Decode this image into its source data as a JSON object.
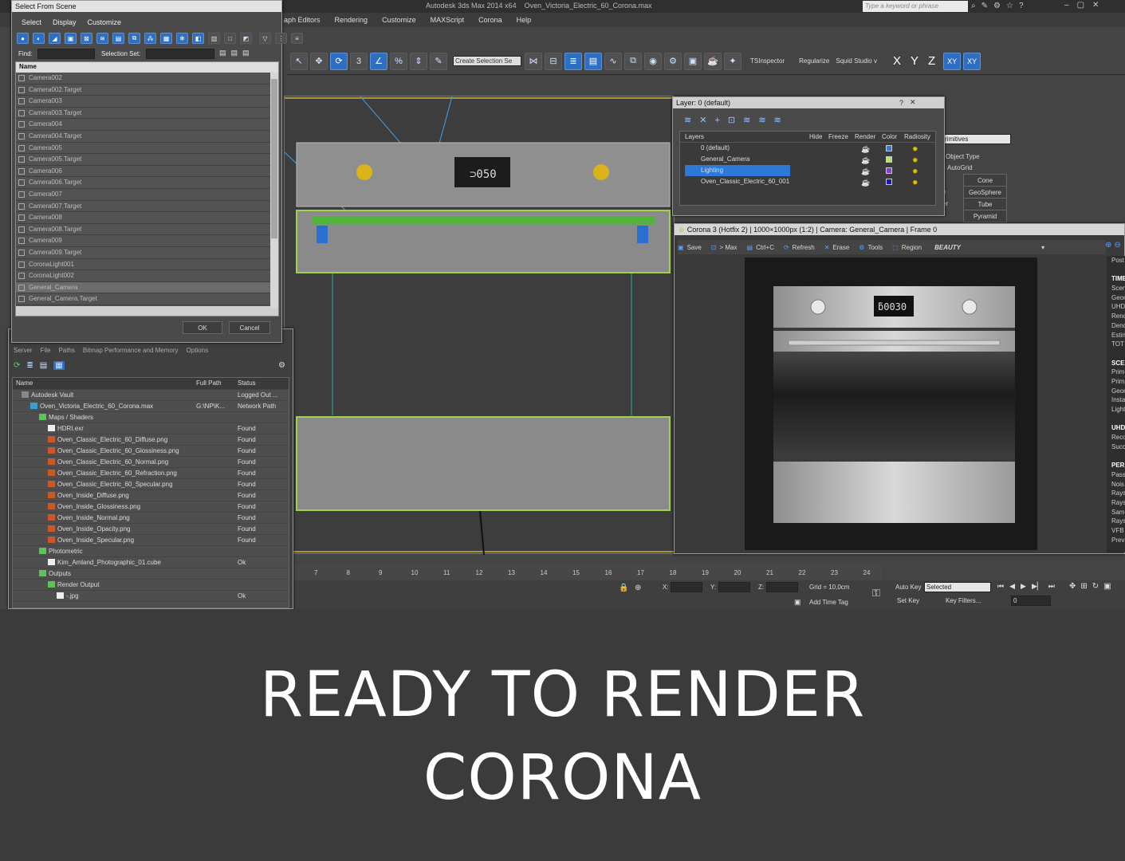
{
  "app": {
    "title": "Autodesk 3ds Max 2014 x64",
    "file": "Oven_Victoria_Electric_60_Corona.max",
    "search_placeholder": "Type a keyword or phrase",
    "menu": [
      "aph Editors",
      "Rendering",
      "Customize",
      "MAXScript",
      "Corona",
      "Help"
    ]
  },
  "toolbar": {
    "selection_set": "Create Selection Se",
    "tsinspector": "TSInspector",
    "regularize": "Regularize",
    "squid": "Squid Studio v",
    "axes": [
      "X",
      "Y",
      "Z",
      "XY",
      "XY"
    ]
  },
  "select_scene": {
    "title": "Select From Scene",
    "menu": [
      "Select",
      "Display",
      "Customize"
    ],
    "find_label": "Find:",
    "selection_set_label": "Selection Set:",
    "column": "Name",
    "items": [
      {
        "label": "Camera002",
        "selected": false
      },
      {
        "label": "Camera002.Target",
        "selected": false
      },
      {
        "label": "Camera003",
        "selected": false
      },
      {
        "label": "Camera003.Target",
        "selected": false
      },
      {
        "label": "Camera004",
        "selected": false
      },
      {
        "label": "Camera004.Target",
        "selected": false
      },
      {
        "label": "Camera005",
        "selected": false
      },
      {
        "label": "Camera005.Target",
        "selected": false
      },
      {
        "label": "Camera006",
        "selected": false
      },
      {
        "label": "Camera006.Target",
        "selected": false
      },
      {
        "label": "Camera007",
        "selected": false
      },
      {
        "label": "Camera007.Target",
        "selected": false
      },
      {
        "label": "Camera008",
        "selected": false
      },
      {
        "label": "Camera008.Target",
        "selected": false
      },
      {
        "label": "Camera009",
        "selected": false
      },
      {
        "label": "Camera009.Target",
        "selected": false
      },
      {
        "label": "CoronaLight001",
        "selected": false
      },
      {
        "label": "CoronaLight002",
        "selected": false
      },
      {
        "label": "General_Camera",
        "selected": true
      },
      {
        "label": "General_Camera.Target",
        "selected": false
      }
    ],
    "ok": "OK",
    "cancel": "Cancel"
  },
  "asset_tracking": {
    "menu": [
      "Server",
      "File",
      "Paths",
      "Bitmap Performance and Memory",
      "Options"
    ],
    "columns": [
      "Name",
      "Full Path",
      "Status"
    ],
    "rows": [
      {
        "indent": 1,
        "icon": "vault",
        "name": "Autodesk Vault",
        "path": "",
        "status": "Logged Out ..."
      },
      {
        "indent": 2,
        "icon": "max",
        "name": "Oven_Victoria_Electric_60_Corona.max",
        "path": "G:\\NP\\K...",
        "status": "Network Path"
      },
      {
        "indent": 3,
        "icon": "folder",
        "name": "Maps / Shaders",
        "path": "",
        "status": ""
      },
      {
        "indent": 4,
        "icon": "file",
        "name": "HDRI.exr",
        "path": "",
        "status": "Found"
      },
      {
        "indent": 4,
        "icon": "image",
        "name": "Oven_Classic_Electric_60_Diffuse.png",
        "path": "",
        "status": "Found"
      },
      {
        "indent": 4,
        "icon": "image",
        "name": "Oven_Classic_Electric_60_Glossiness.png",
        "path": "",
        "status": "Found"
      },
      {
        "indent": 4,
        "icon": "image",
        "name": "Oven_Classic_Electric_60_Normal.png",
        "path": "",
        "status": "Found"
      },
      {
        "indent": 4,
        "icon": "image",
        "name": "Oven_Classic_Electric_60_Refraction.png",
        "path": "",
        "status": "Found"
      },
      {
        "indent": 4,
        "icon": "image",
        "name": "Oven_Classic_Electric_60_Specular.png",
        "path": "",
        "status": "Found"
      },
      {
        "indent": 4,
        "icon": "image",
        "name": "Oven_Inside_Diffuse.png",
        "path": "",
        "status": "Found"
      },
      {
        "indent": 4,
        "icon": "image",
        "name": "Oven_Inside_Glossiness.png",
        "path": "",
        "status": "Found"
      },
      {
        "indent": 4,
        "icon": "image",
        "name": "Oven_Inside_Normal.png",
        "path": "",
        "status": "Found"
      },
      {
        "indent": 4,
        "icon": "image",
        "name": "Oven_Inside_Opacity.png",
        "path": "",
        "status": "Found"
      },
      {
        "indent": 4,
        "icon": "image",
        "name": "Oven_Inside_Specular.png",
        "path": "",
        "status": "Found"
      },
      {
        "indent": 3,
        "icon": "folder",
        "name": "Photometric",
        "path": "",
        "status": ""
      },
      {
        "indent": 4,
        "icon": "file",
        "name": "Kim_Amland_Photographic_01.cube",
        "path": "",
        "status": "Ok"
      },
      {
        "indent": 3,
        "icon": "folder",
        "name": "Outputs",
        "path": "",
        "status": ""
      },
      {
        "indent": 4,
        "icon": "folder",
        "name": "Render Output",
        "path": "",
        "status": ""
      },
      {
        "indent": 5,
        "icon": "file",
        "name": "-.jpg",
        "path": "",
        "status": "Ok"
      }
    ]
  },
  "layer_manager": {
    "title": "Layer: 0 (default)",
    "columns": [
      "Layers",
      "Hide",
      "Freeze",
      "Render",
      "Color",
      "Radiosity"
    ],
    "layers": [
      {
        "name": "0 (default)",
        "color": "#3b78d8",
        "selected": false
      },
      {
        "name": "General_Camera",
        "color": "#b6e36e",
        "selected": false
      },
      {
        "name": "Lighting",
        "color": "#8a3fd1",
        "selected": true
      },
      {
        "name": "Oven_Classic_Electric_60_001",
        "color": "#1a1ab0",
        "selected": false
      }
    ]
  },
  "command_panel": {
    "dropdown": "rimitives",
    "rollout": "Object Type",
    "autogrid": "AutoGrid",
    "buttons": [
      "Cone",
      "GeoSphere",
      "Tube",
      "Pyramid"
    ],
    "labels": [
      "e",
      "er"
    ]
  },
  "vfb": {
    "title": "Corona 3 (Hotfix 2) | 1000×1000px (1:2) | Camera: General_Camera | Frame 0",
    "buttons": [
      "Save",
      "> Max",
      "Ctrl+C",
      "Refresh",
      "Erase",
      "Tools",
      "Region"
    ],
    "channel": "BEAUTY",
    "oven_display": "ƃ0030",
    "side": [
      {
        "t": "Post",
        "h": false
      },
      {
        "t": "",
        "h": false
      },
      {
        "t": "TIME",
        "h": true
      },
      {
        "t": "Scen",
        "h": false
      },
      {
        "t": "Geor",
        "h": false
      },
      {
        "t": "UHD",
        "h": false
      },
      {
        "t": "Renc",
        "h": false
      },
      {
        "t": "Denc",
        "h": false
      },
      {
        "t": "Estin",
        "h": false
      },
      {
        "t": "TOT",
        "h": false
      },
      {
        "t": "",
        "h": false
      },
      {
        "t": "SCEN",
        "h": true
      },
      {
        "t": "Prim",
        "h": false
      },
      {
        "t": "Prim",
        "h": false
      },
      {
        "t": "Geor",
        "h": false
      },
      {
        "t": "Insta",
        "h": false
      },
      {
        "t": "Light",
        "h": false
      },
      {
        "t": "",
        "h": false
      },
      {
        "t": "UHD",
        "h": true
      },
      {
        "t": "Reco",
        "h": false
      },
      {
        "t": "Succ",
        "h": false
      },
      {
        "t": "",
        "h": false
      },
      {
        "t": "PERI",
        "h": true
      },
      {
        "t": "Passe",
        "h": false
      },
      {
        "t": "Nois",
        "h": false
      },
      {
        "t": "Rays",
        "h": false
      },
      {
        "t": "Rays",
        "h": false
      },
      {
        "t": "Samp",
        "h": false
      },
      {
        "t": "Rays",
        "h": false
      },
      {
        "t": "VFB",
        "h": false
      },
      {
        "t": "Prev",
        "h": false
      }
    ]
  },
  "timeline": {
    "ticks": [
      "7",
      "8",
      "9",
      "10",
      "11",
      "12",
      "13",
      "14",
      "15",
      "16",
      "17",
      "18",
      "19",
      "20",
      "21",
      "22",
      "23",
      "24"
    ]
  },
  "status": {
    "x_label": "X:",
    "y_label": "Y:",
    "z_label": "Z:",
    "grid": "Grid = 10,0cm",
    "add_time_tag": "Add Time Tag",
    "auto_key": "Auto Key",
    "set_key": "Set Key",
    "selected": "Selected",
    "key_filters": "Key Filters...",
    "frame": "0"
  },
  "caption": {
    "line1": "READY TO RENDER",
    "line2": "CORONA"
  }
}
